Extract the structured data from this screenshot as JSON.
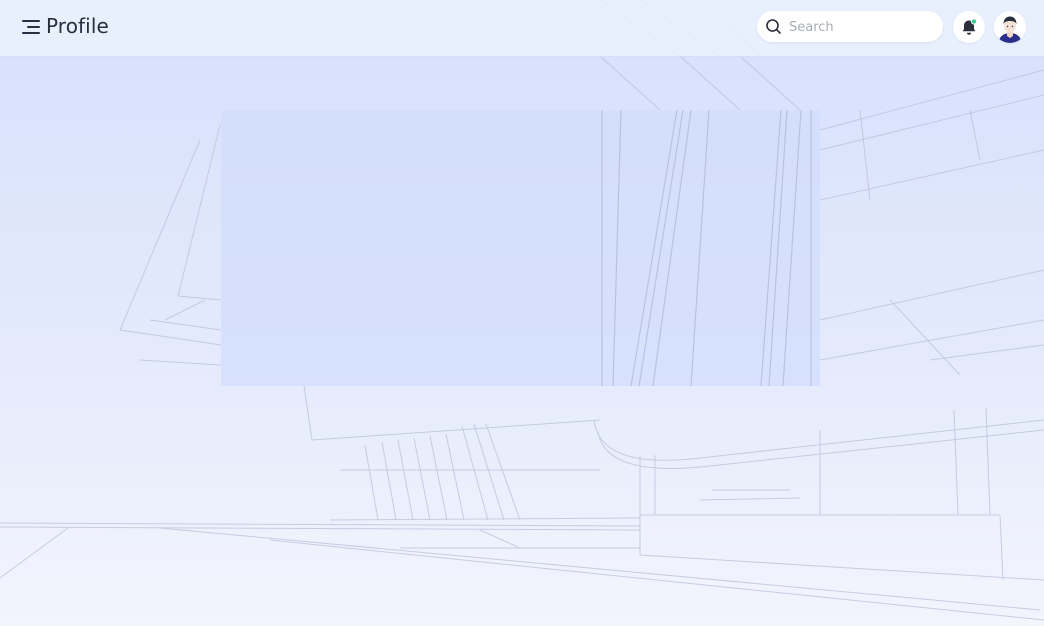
{
  "header": {
    "title": "Profile",
    "search": {
      "placeholder": "Search",
      "value": ""
    },
    "notifications": {
      "has_unread": true,
      "indicator_color": "#2ecc8a"
    }
  },
  "icons": {
    "menu": "menu-icon",
    "search": "search-icon",
    "bell": "bell-icon",
    "avatar": "avatar"
  },
  "colors": {
    "background_top": "#d6e0fd",
    "background_bottom": "#f3f5fd",
    "title_text": "#2b2f3a",
    "avatar_shirt": "#2b2f8a"
  }
}
